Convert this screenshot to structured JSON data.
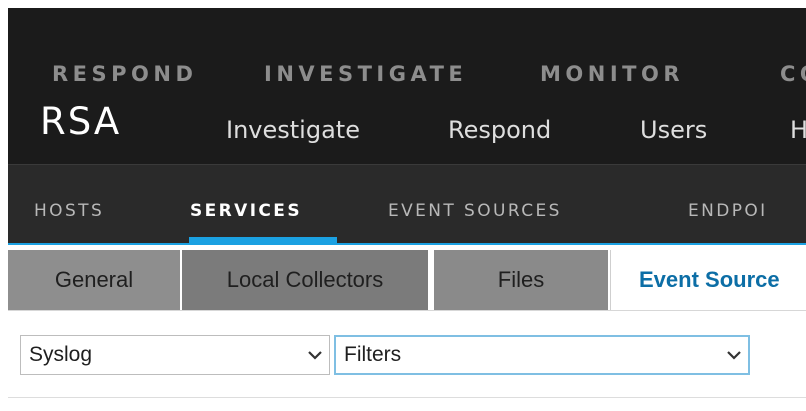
{
  "top_menu": {
    "items": [
      "RESPOND",
      "INVESTIGATE",
      "MONITOR",
      "CON"
    ]
  },
  "brand": {
    "logo_text": "RSA"
  },
  "primary_nav": {
    "items": [
      "Investigate",
      "Respond",
      "Users",
      "H"
    ]
  },
  "secondary_nav": {
    "items": [
      "HOSTS",
      "SERVICES",
      "EVENT SOURCES",
      "ENDPOI"
    ],
    "active": "SERVICES",
    "accent_color": "#1ba1e2"
  },
  "tabs": {
    "items": [
      "General",
      "Local Collectors",
      "Files",
      "Event Source"
    ],
    "active": "Event Source",
    "active_color": "#0c6ea6"
  },
  "toolbar": {
    "source_type_select": {
      "value": "Syslog",
      "icon": "chevron-down-icon"
    },
    "filters_select": {
      "value": "Filters",
      "icon": "chevron-down-icon"
    }
  }
}
